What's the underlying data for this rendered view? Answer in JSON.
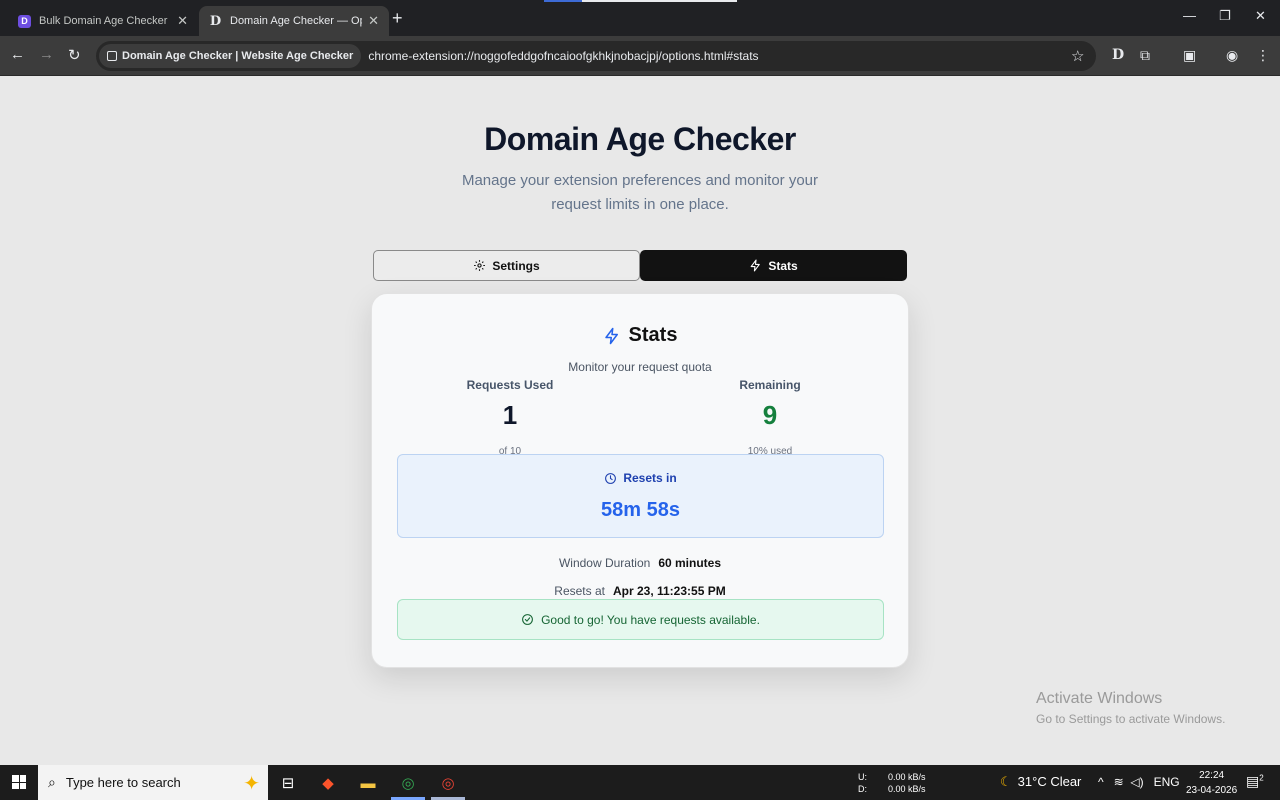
{
  "browser": {
    "tabs": [
      {
        "title": "Bulk Domain Age Checker [FRE",
        "active": false
      },
      {
        "title": "Domain Age Checker — Option",
        "active": true
      }
    ],
    "new_tab": "+",
    "chip_label": "Domain Age Checker | Website Age Checker",
    "url": "chrome-extension://noggofeddgofncaioofgkhkjnobacjpj/options.html#stats"
  },
  "page": {
    "title": "Domain Age Checker",
    "subtitle": "Manage your extension preferences and monitor your request limits in one place.",
    "tabs": {
      "settings": "Settings",
      "stats": "Stats"
    },
    "card": {
      "title": "Stats",
      "subtitle": "Monitor your request quota",
      "used": {
        "label": "Requests Used",
        "value": "1",
        "caption": "of 10"
      },
      "remaining": {
        "label": "Remaining",
        "value": "9",
        "caption": "10% used"
      },
      "reset": {
        "label": "Resets in",
        "value": "58m 58s"
      },
      "window_duration": {
        "label": "Window Duration",
        "value": "60 minutes"
      },
      "resets_at": {
        "label": "Resets at",
        "value": "Apr 23, 11:23:55 PM"
      },
      "status": "Good to go! You have requests available."
    },
    "activate": {
      "line1": "Activate Windows",
      "line2": "Go to Settings to activate Windows."
    }
  },
  "taskbar": {
    "search_placeholder": "Type here to search",
    "net_up_label": "U:",
    "net_up": "0.00 kB/s",
    "net_down_label": "D:",
    "net_down": "0.00 kB/s",
    "weather": "31°C  Clear",
    "lang": "ENG",
    "time": "22:24",
    "date": "23-04-2026",
    "notif_count": "2"
  },
  "colors": {
    "accent": "#2563eb",
    "success": "#15803d",
    "dark": "#121212"
  }
}
